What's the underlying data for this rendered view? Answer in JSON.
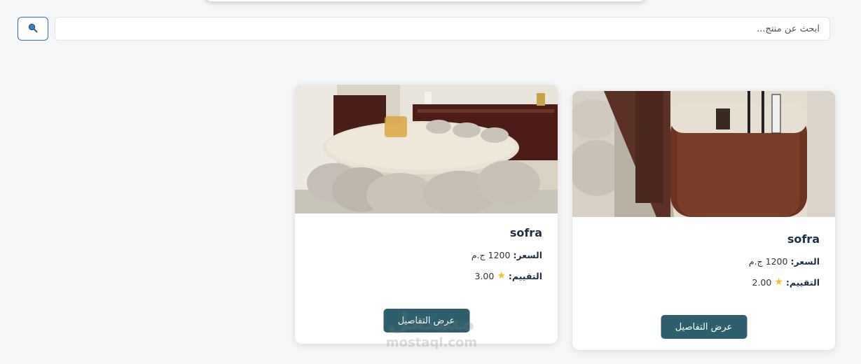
{
  "search": {
    "placeholder": "ابحث عن منتج...",
    "value": ""
  },
  "products": [
    {
      "name": "sofra",
      "price_label": "السعر:",
      "price_value": "1200 ج.م",
      "rating_label": "التقييم:",
      "rating_value": "3.00",
      "button_label": "عرض التفاصيل"
    },
    {
      "name": "sofra",
      "price_label": "السعر:",
      "price_value": "1200 ج.م",
      "rating_label": "التقييم:",
      "rating_value": "2.00",
      "button_label": "عرض التفاصيل"
    }
  ],
  "icons": {
    "search": "search-icon",
    "star": "star-icon"
  },
  "colors": {
    "button_bg": "#2e5f6e",
    "accent_border": "#2f6fb3",
    "star": "#f2c230",
    "title": "#1d2f44"
  },
  "watermark": {
    "arabic": "مستقل",
    "latin": "mostaql.com"
  }
}
